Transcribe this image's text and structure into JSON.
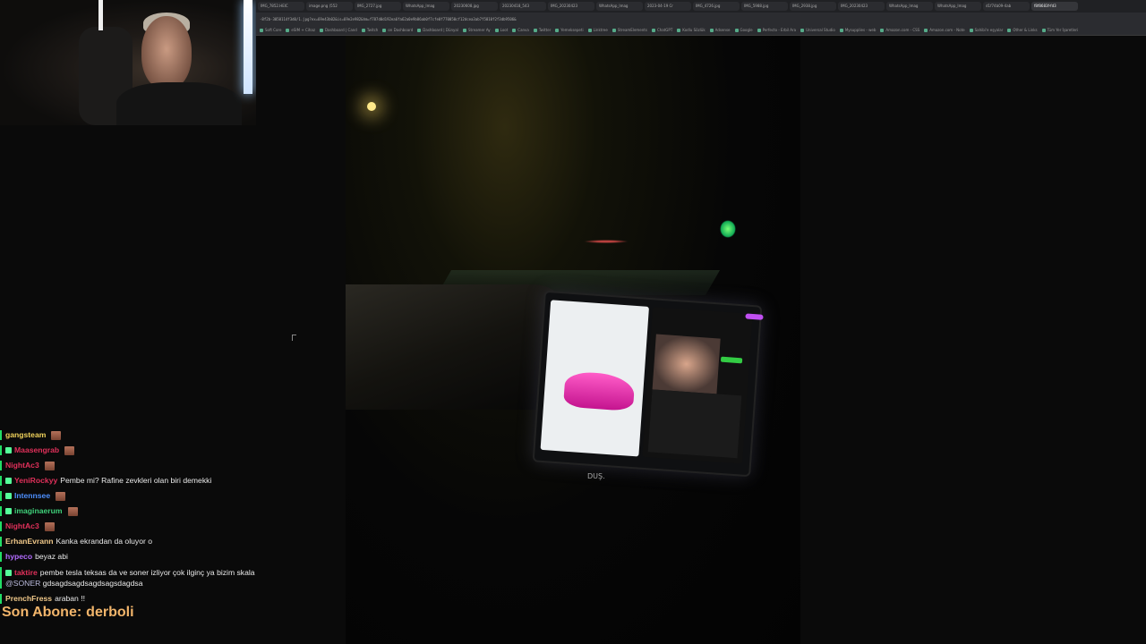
{
  "browser": {
    "tabs": [
      "IMG_7852.HEIC",
      "image.png (552",
      "IMG_2727.jpg",
      "WhatsApp_Imag",
      "20230608.jpg",
      "20230418_543",
      "IMG_20230423",
      "WhatsApp_Imag",
      "2023-04-19 Cr",
      "IMG_4726.jpg",
      "IMG_5988.jpg",
      "IMG_2938.jpg",
      "IMG_20230423",
      "WhatsApp_Imag",
      "WhatsApp_Imag",
      "d1f74b09-4ab",
      "f8f8683f-fd3"
    ],
    "url": "-8f2b-3050114f3d0/1.jpg?ex=69e43b02&is=69e2e982&hm=f787d0d192ea6fa62a0e9b86ab0f7cfe0f770050cf12dcea3ab7f5810f2f3db9506&",
    "bookmarks": [
      "Soft Core",
      "eSIM + Cihaz",
      "Dashboard | Cand",
      "Twitch",
      "on Dashboard",
      "Dashboard | Dünyal",
      "Streamer Ay",
      "Loot",
      "Canva",
      "Twitter",
      "Yemeksepeti",
      "Linktree",
      "StreamElements",
      "ChatGPT",
      "Kodlu Sözlük",
      "Adsense",
      "Google",
      "Perfecto - Erbil Ara",
      "Universal Studio",
      "Mysupplies - web",
      "Amazon.com - CSS",
      "Amazon.com - Note",
      "Sahibi'e eşyalar",
      "Other & Links",
      "Tüm Yer İşaretleri"
    ]
  },
  "photo": {
    "screen_bottom_label": "DUŞ."
  },
  "chat": [
    {
      "user": "gangsteam",
      "color": "#f1d35b",
      "text": "",
      "emote": true
    },
    {
      "user": "Maasengrab",
      "color": "#e0305a",
      "text": "",
      "emote": true,
      "badge": true
    },
    {
      "user": "NightAc3",
      "color": "#e0305a",
      "text": "",
      "emote": true
    },
    {
      "user": "YeniRockyy",
      "color": "#e0305a",
      "text": "Pembe mi? Rafine zevkleri olan biri demekki",
      "badge": true
    },
    {
      "user": "Intennsee",
      "color": "#4d8fff",
      "text": "",
      "emote": true,
      "badge": true
    },
    {
      "user": "imaginaerum",
      "color": "#3fd17a",
      "text": "",
      "emote": true,
      "badge": true
    },
    {
      "user": "NightAc3",
      "color": "#e0305a",
      "text": "",
      "emote": true
    },
    {
      "user": "ErhanEvrann",
      "color": "#f1c98a",
      "text": "Kanka ekrandan da oluyor o"
    },
    {
      "user": "hypeco",
      "color": "#b36cff",
      "text": "beyaz abi"
    },
    {
      "user": "taktire",
      "color": "#e0305a",
      "text": "pembe tesla teksas da ve soner izliyor çok ilginç ya bizim skala",
      "mention": "@SONER",
      "text2": "gdsagdsagdsagdsagsdagdsa",
      "badge": true
    },
    {
      "user": "PrenchFress",
      "color": "#f1c98a",
      "text": "araban !!"
    }
  ],
  "last_sub": {
    "label": "Son Abone:",
    "name": "derboli"
  }
}
